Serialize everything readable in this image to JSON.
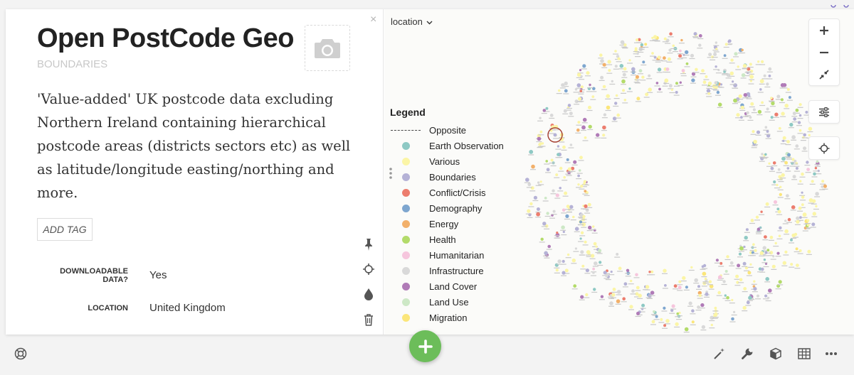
{
  "details": {
    "title": "Open PostCode Geo",
    "category": "BOUNDARIES",
    "description": "'Value-added' UK postcode data excluding Northern Ireland containing hierarchical postcode areas (districts sectors etc) as well as latitude/longitude easting/northing and more.",
    "add_tag_label": "ADD TAG",
    "close_glyph": "×",
    "properties": [
      {
        "label": "DOWNLOADABLE DATA?",
        "value": "Yes"
      },
      {
        "label": "LOCATION",
        "value": "United Kingdom"
      }
    ]
  },
  "map": {
    "view_selector": "location",
    "legend": {
      "title": "Legend",
      "items": [
        {
          "label": "Opposite",
          "color": "#444444",
          "style": "dashed"
        },
        {
          "label": "Earth Observation",
          "color": "#8ec9c4"
        },
        {
          "label": "Various",
          "color": "#fbf5a6"
        },
        {
          "label": "Boundaries",
          "color": "#b5b2d6"
        },
        {
          "label": "Conflict/Crisis",
          "color": "#ec7d6e"
        },
        {
          "label": "Demography",
          "color": "#7ea6cf"
        },
        {
          "label": "Energy",
          "color": "#f2b06a"
        },
        {
          "label": "Health",
          "color": "#b3db6a"
        },
        {
          "label": "Humanitarian",
          "color": "#f6c6dd"
        },
        {
          "label": "Infrastructure",
          "color": "#d9d9d9"
        },
        {
          "label": "Land Cover",
          "color": "#b07bb7"
        },
        {
          "label": "Land Use",
          "color": "#cde8c6"
        },
        {
          "label": "Migration",
          "color": "#fbe67a"
        }
      ]
    }
  },
  "colors": {
    "accent_green": "#6cbd5a",
    "selected_ring": "#a33b2e"
  }
}
